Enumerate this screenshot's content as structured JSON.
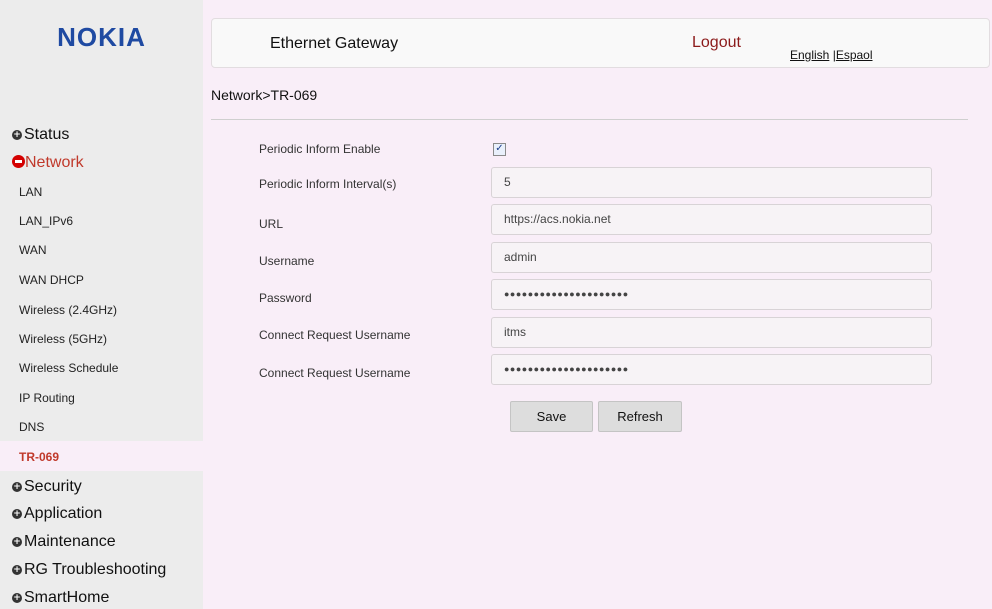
{
  "brand": {
    "logo": "NOKIA",
    "logo_color": "#1f4aa2"
  },
  "header": {
    "title": "Ethernet Gateway",
    "logout": "Logout",
    "logout_color": "#8b1a1a",
    "lang_english": "English",
    "lang_sep": " |",
    "lang_espaol": "Espaol"
  },
  "breadcrumb": "Network>TR-069",
  "sidebar": {
    "status": "Status",
    "network": "Network",
    "network_items": [
      "LAN",
      "LAN_IPv6",
      "WAN",
      "WAN DHCP",
      "Wireless (2.4GHz)",
      "Wireless (5GHz)",
      "Wireless Schedule",
      "IP Routing",
      "DNS",
      "TR-069"
    ],
    "active_item": "TR-069",
    "security": "Security",
    "application": "Application",
    "maintenance": "Maintenance",
    "rg_troubleshooting": "RG Troubleshooting",
    "smarthome": "SmartHome"
  },
  "form": {
    "periodic_inform_enable": {
      "label": "Periodic Inform Enable",
      "checked": true,
      "mark": "✓"
    },
    "periodic_inform_interval": {
      "label": "Periodic Inform Interval(s)",
      "value": "5"
    },
    "url": {
      "label": "URL",
      "value": "https://acs.nokia.net"
    },
    "username": {
      "label": "Username",
      "value": "admin"
    },
    "password": {
      "label": "Password",
      "value": "●●●●●●●●●●●●●●●●●●●●●"
    },
    "connect_request_username": {
      "label": "Connect Request Username",
      "value": "itms"
    },
    "connect_request_password": {
      "label": "Connect Request Username",
      "value": "●●●●●●●●●●●●●●●●●●●●●"
    }
  },
  "buttons": {
    "save": "Save",
    "refresh": "Refresh"
  },
  "icons": {
    "expand": "plus-circle-icon",
    "collapse": "minus-circle-icon"
  }
}
